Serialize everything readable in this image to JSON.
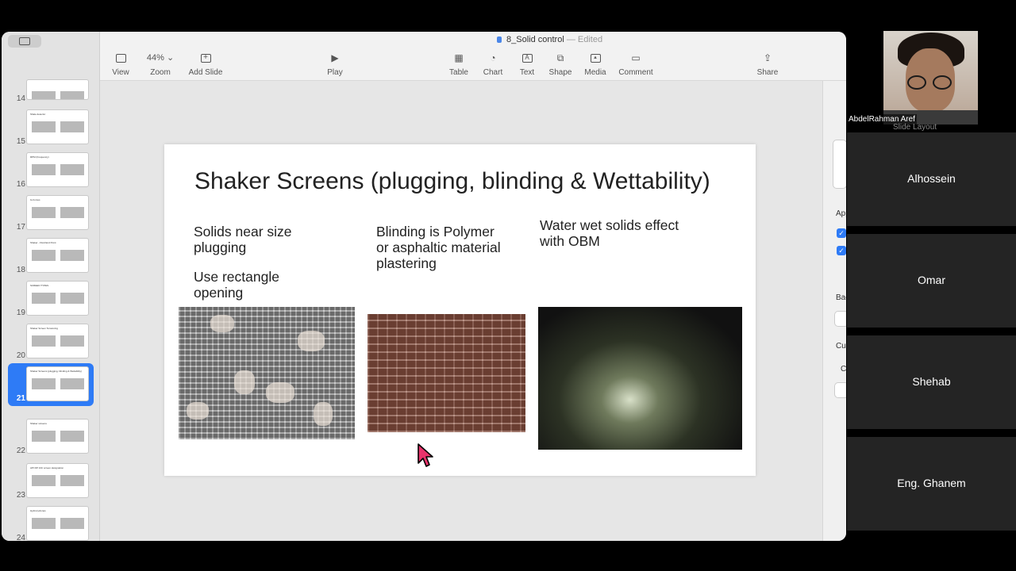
{
  "window": {
    "title": "8_Solid control",
    "title_separator": "—",
    "status": "Edited"
  },
  "toolbar": {
    "view": "View",
    "zoom_value": "44%",
    "zoom": "Zoom",
    "add_slide": "Add Slide",
    "play": "Play",
    "table": "Table",
    "chart": "Chart",
    "text": "Text",
    "shape": "Shape",
    "media": "Media",
    "comment": "Comment",
    "share": "Share"
  },
  "sidebar": {
    "slides": [
      {
        "num": "14",
        "title": ""
      },
      {
        "num": "15",
        "title": "Shale detector"
      },
      {
        "num": "16",
        "title": "RPM (Frequency)"
      },
      {
        "num": "17",
        "title": "G-Forces"
      },
      {
        "num": "18",
        "title": "Shaker - Fluid End Point"
      },
      {
        "num": "19",
        "title": "SCREEN TYPES"
      },
      {
        "num": "20",
        "title": "Shaker Screen Tensioning"
      },
      {
        "num": "21",
        "title": "Shaker Screens (plugging, blinding & Wettability)"
      },
      {
        "num": "22",
        "title": "Shaker screens"
      },
      {
        "num": "23",
        "title": "API RP 13C screen designation"
      },
      {
        "num": "24",
        "title": "Hydrocyclones"
      }
    ],
    "selected": "21"
  },
  "slide": {
    "title": "Shaker Screens (plugging, blinding & Wettability)",
    "col1_line1": "Solids near size",
    "col1_line2": "plugging",
    "col1_line3": "Use rectangle",
    "col1_line4": "opening",
    "col2_line1": "Blinding is Polymer",
    "col2_line2": "or asphaltic material",
    "col2_line3": "plastering",
    "col3_line1": "Water wet solids effect",
    "col3_line2": "with OBM"
  },
  "inspector": {
    "slide_layout": "Slide Layout",
    "app": "App",
    "bac": "Bac",
    "cur": "Cur",
    "co": "Co"
  },
  "meeting": {
    "self_name": "AbdelRahman Aref",
    "participants": [
      "Alhossein",
      "Omar",
      "Shehab",
      "Eng. Ghanem"
    ]
  },
  "colors": {
    "accent": "#2e7bf6",
    "cursor": "#e8336b"
  }
}
